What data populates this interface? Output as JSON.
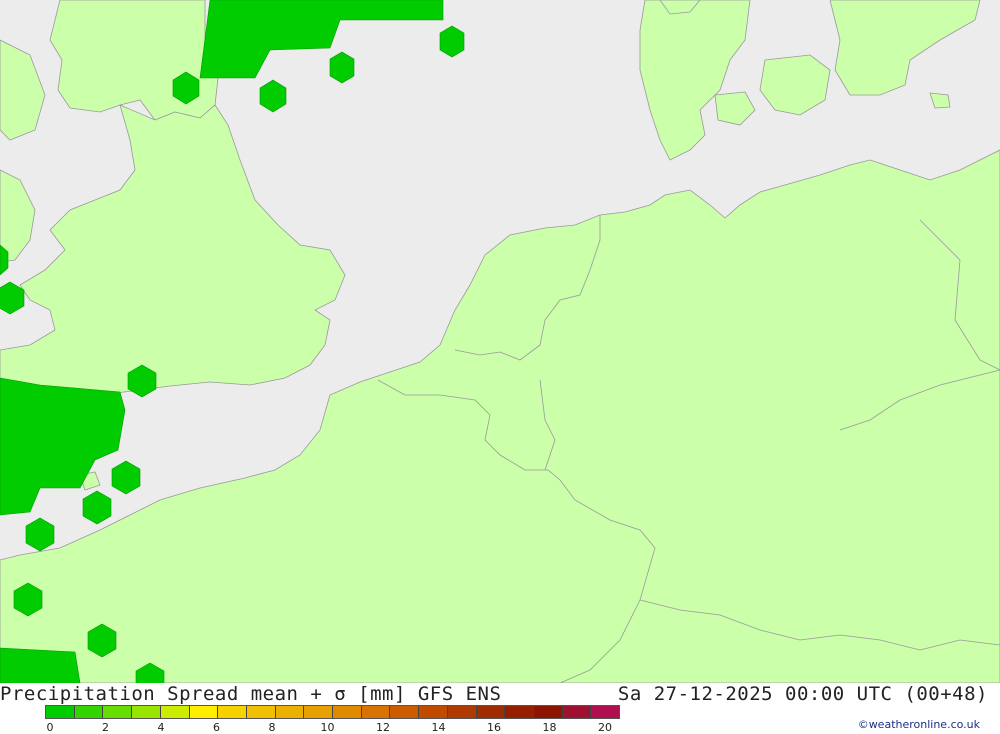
{
  "map": {
    "colors": {
      "sea": "#ececec",
      "land": "#ccffaa",
      "precip": "#00cc00",
      "border": "#999999"
    }
  },
  "footer": {
    "title": "Precipitation Spread mean + σ [mm] GFS ENS",
    "timestamp": "Sa 27-12-2025 00:00 UTC (00+48)",
    "credit": "©weatheronline.co.uk",
    "scale": {
      "colors": [
        "#00cc00",
        "#33d400",
        "#66dc00",
        "#99e400",
        "#ccec00",
        "#ffee00",
        "#f5d200",
        "#f0c000",
        "#ebb000",
        "#e6a000",
        "#e08a00",
        "#d87200",
        "#cc5c00",
        "#c04a00",
        "#b03a00",
        "#a02c00",
        "#961f00",
        "#8c1400",
        "#a01030",
        "#b01050"
      ],
      "ticks": [
        "0",
        "2",
        "4",
        "6",
        "8",
        "10",
        "12",
        "14",
        "16",
        "18",
        "20"
      ]
    }
  }
}
